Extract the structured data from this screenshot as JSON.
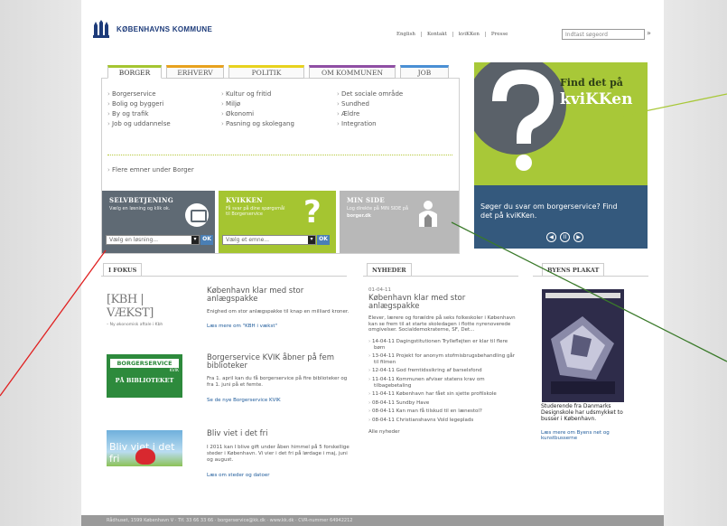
{
  "header": {
    "logo_text": "KØBENHAVNS KOMMUNE",
    "top_links": [
      "English",
      "Kontakt",
      "kviKKen",
      "Presse"
    ],
    "search_placeholder": "Indtast søgeord",
    "search_go": "»"
  },
  "tabs": [
    {
      "label": "BORGER",
      "color": "#a5c531",
      "active": true
    },
    {
      "label": "ERHVERV",
      "color": "#e8a21e",
      "active": false
    },
    {
      "label": "POLITIK",
      "color": "#e8d21e",
      "active": false
    },
    {
      "label": "OM KOMMUNEN",
      "color": "#8f4fa4",
      "active": false
    },
    {
      "label": "JOB",
      "color": "#4a8fd4",
      "active": false
    }
  ],
  "menu": {
    "items": [
      "Borgerservice",
      "Kultur og fritid",
      "Det sociale område",
      "Bolig og byggeri",
      "Miljø",
      "Sundhed",
      "By og trafik",
      "Økonomi",
      "Ældre",
      "Job og uddannelse",
      "Pasning og skolegang",
      "Integration"
    ],
    "more": "Flere emner under Borger"
  },
  "boxes": {
    "selvbetjening": {
      "title": "SELVBETJENING",
      "text": "Vælg en løsning og klik ok.",
      "select": "Vælg en løsning...",
      "ok": "OK"
    },
    "kvikken": {
      "title": "KVIKKEN",
      "text": "Få svar på dine spørgsmål til Borgerservice",
      "select": "Vælg et emne...",
      "ok": "OK"
    },
    "min_side": {
      "title": "MIN SIDE",
      "text": "Log direkte på MIN SIDE på",
      "link": "borger.dk"
    }
  },
  "ad": {
    "line1": "Find det på",
    "line2": "kviKKen",
    "text": "Søger du svar om borgerservice? Find det på kviKKen.",
    "controls": [
      "◀",
      "II",
      "▶"
    ]
  },
  "fokus": {
    "heading": "I FOKUS",
    "items": [
      {
        "img_title": "[KBH | VÆKST]",
        "img_sub": "– Ny økonomisk aftale i Kbh",
        "title": "København klar med stor anlægspakke",
        "body": "Enighed om stor anlægspakke til knap en milliard kroner.",
        "link": "Læs mere om \"KBH i vækst\""
      },
      {
        "img_title": "BORGERSERVICE",
        "img_sub": "PÅ BIBLIOTEKET",
        "img_badge": "KVIK",
        "title": "Borgerservice KVIK åbner på fem biblioteker",
        "body": "Fra 1. april kan du få borgerservice på fire biblioteker og fra 1. juni på et femte.",
        "link": "Se de nye Borgerservice KVIK"
      },
      {
        "img_title": "Bliv viet i det fri",
        "title": "Bliv viet i det fri",
        "body": "I 2011 kan I blive gift under åben himmel på 5 forskellige steder i København. Vi vier i det fri på lørdage i maj, juni og august.",
        "link": "Læs om steder og datoer"
      }
    ]
  },
  "nyheder": {
    "heading": "NYHEDER",
    "date": "01-04-11",
    "title": "København klar med stor anlægspakke",
    "lead": "Elever, lærere og forældre på seks folkeskoler i København kan se frem til at starte skoledagen i flotte nyrenoverede omgivelser. Socialdemokraterne, SF, Det...",
    "items": [
      "14-04-11 Dagingstitutionen Trylleflejten er klar til flere børn",
      "13-04-11 Projekt for anonym stofmisbrugsbehandling går til filmen",
      "12-04-11 God fremtidssikring af barselsfond",
      "11-04-11 Kommunen afviser statens krav om tilbagebetaling",
      "11-04-11 København har fået sin sjette profilskole",
      "08-04-11 Sundby Have",
      "08-04-11 Kan man få tilskud til en lænestol?",
      "08-04-11 Christianshavns Vold legeplads"
    ],
    "all": "Alle nyheder"
  },
  "plakat": {
    "heading": "BYENS PLAKAT",
    "text": "Studerende fra Danmarks Designskole har udsmykket to busser i København.",
    "link": "Læs mere om Byens net og kunstbusserne"
  },
  "footer": "Rådhuset, 1599 København V  ·  Tlf. 33 66 33 66  ·  borgerservice@kk.dk  ·  www.kk.dk  ·  CVR-nummer 64942212"
}
